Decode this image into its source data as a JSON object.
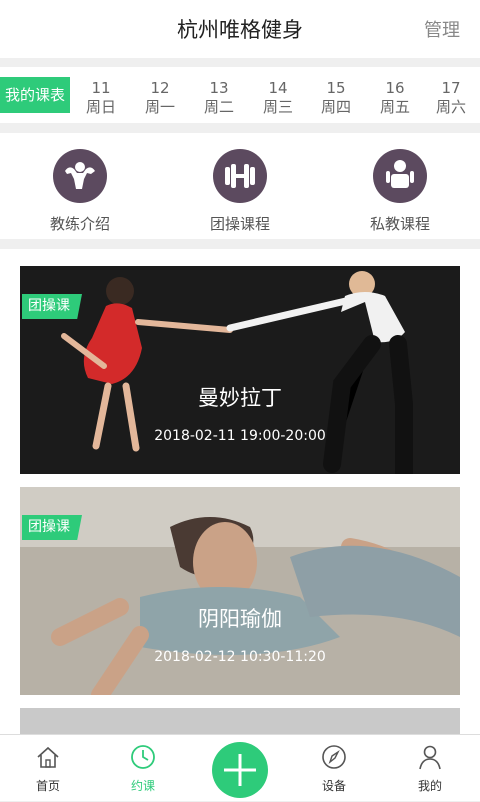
{
  "header": {
    "title": "杭州唯格健身",
    "manage_label": "管理"
  },
  "schedule": {
    "my_label": "我的课表",
    "days": [
      {
        "num": "11",
        "weekday": "周日"
      },
      {
        "num": "12",
        "weekday": "周一"
      },
      {
        "num": "13",
        "weekday": "周二"
      },
      {
        "num": "14",
        "weekday": "周三"
      },
      {
        "num": "15",
        "weekday": "周四"
      },
      {
        "num": "16",
        "weekday": "周五"
      },
      {
        "num": "17",
        "weekday": "周六"
      }
    ]
  },
  "quick_links": [
    {
      "label": "教练介绍",
      "icon": "muscle-icon"
    },
    {
      "label": "团操课程",
      "icon": "dumbbell-icon"
    },
    {
      "label": "私教课程",
      "icon": "trainer-icon"
    }
  ],
  "classes": [
    {
      "tag": "团操课",
      "name": "曼妙拉丁",
      "time": "2018-02-11 19:00-20:00"
    },
    {
      "tag": "团操课",
      "name": "阴阳瑜伽",
      "time": "2018-02-12 10:30-11:20"
    }
  ],
  "tabs": [
    {
      "label": "首页",
      "icon": "home-icon"
    },
    {
      "label": "约课",
      "icon": "clock-icon",
      "active": true
    },
    {
      "label": "",
      "icon": "plus-icon"
    },
    {
      "label": "设备",
      "icon": "compass-icon"
    },
    {
      "label": "我的",
      "icon": "user-icon"
    }
  ],
  "colors": {
    "accent": "#2ecb7a",
    "icon_bg": "#5c4a5f"
  }
}
